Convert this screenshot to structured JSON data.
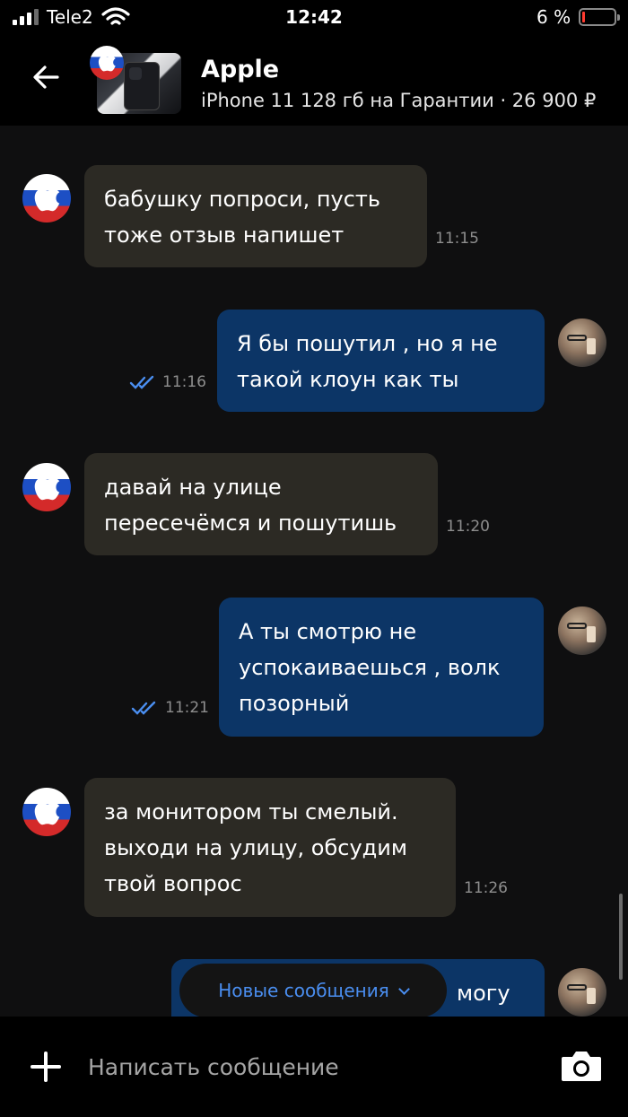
{
  "status_bar": {
    "carrier": "Tele2",
    "time": "12:42",
    "battery_percent": "6 %",
    "battery_level": 0.06
  },
  "header": {
    "title": "Apple",
    "subtitle": "iPhone 11 128 гб на Гарантии · 26 900 ₽",
    "back_icon": "arrow-left-icon",
    "thumbnail": "product-photo"
  },
  "messages": [
    {
      "side": "in",
      "lines": [
        "бабушку попроси, пусть",
        "тоже отзыв напишет"
      ],
      "time": "11:15"
    },
    {
      "side": "out",
      "lines": [
        "Я бы пошутил , но я не",
        "такой клоун как ты"
      ],
      "time": "11:16",
      "status": "read"
    },
    {
      "side": "in",
      "lines": [
        "давай на улице",
        "пересечёмся и пошутишь"
      ],
      "time": "11:20"
    },
    {
      "side": "out",
      "lines": [
        "А ты смотрю не",
        "успокаиваешься , волк",
        "позорный"
      ],
      "time": "11:21",
      "status": "read"
    },
    {
      "side": "in",
      "lines": [
        "за монитором ты смелый.",
        "выходи на улицу, обсудим",
        "твой вопрос"
      ],
      "time": "11:26"
    },
    {
      "side": "out",
      "lines": [
        "могу"
      ],
      "time": "",
      "status": ""
    }
  ],
  "new_messages_button": {
    "label": "Новые сообщения",
    "icon": "chevron-down-icon"
  },
  "composer": {
    "placeholder": "Написать сообщение",
    "add_icon": "plus-icon",
    "camera_icon": "camera-icon"
  },
  "colors": {
    "incoming_bubble": "#2c2a24",
    "outgoing_bubble": "#0c3566",
    "link_blue": "#4a8ef0",
    "background": "#0f0f10"
  }
}
